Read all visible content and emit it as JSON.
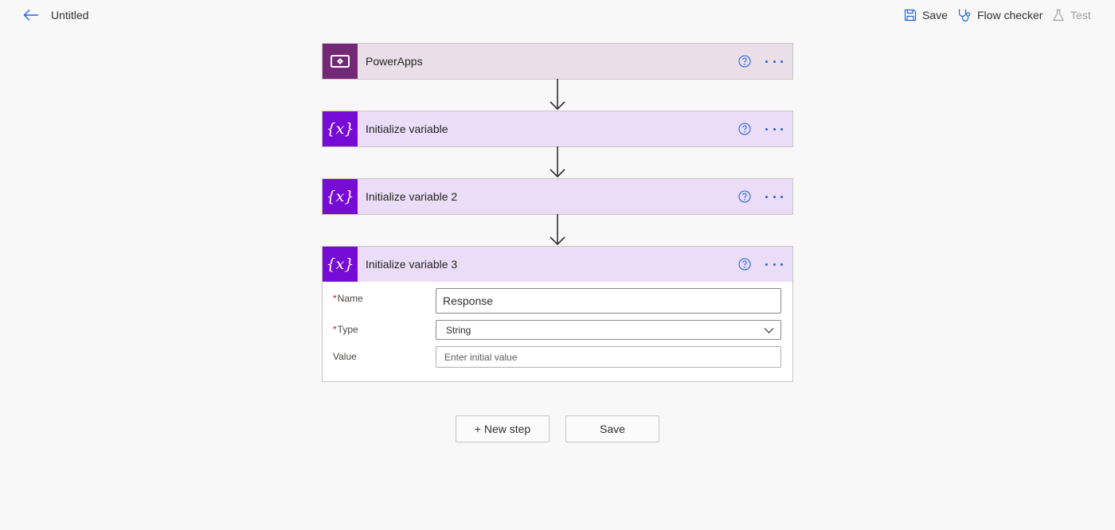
{
  "header": {
    "title": "Untitled",
    "save_label": "Save",
    "flow_checker_label": "Flow checker",
    "test_label": "Test"
  },
  "steps": [
    {
      "title": "PowerApps",
      "icon": "powerapps-icon"
    },
    {
      "title": "Initialize variable",
      "icon": "variable-icon"
    },
    {
      "title": "Initialize variable 2",
      "icon": "variable-icon"
    },
    {
      "title": "Initialize variable 3",
      "icon": "variable-icon",
      "expanded": true
    }
  ],
  "form": {
    "required_marker": "*",
    "name_label": "Name",
    "name_value": "Response",
    "type_label": "Type",
    "type_value": "String",
    "value_label": "Value",
    "value_placeholder": "Enter initial value"
  },
  "footer": {
    "new_step_label": "+ New step",
    "save_label": "Save"
  },
  "colors": {
    "accent": "#2266e3",
    "powerapps": "#742774",
    "variable": "#770bd6",
    "powerapps_header": "#eadfe8",
    "variable_header": "#ebdcf7"
  }
}
